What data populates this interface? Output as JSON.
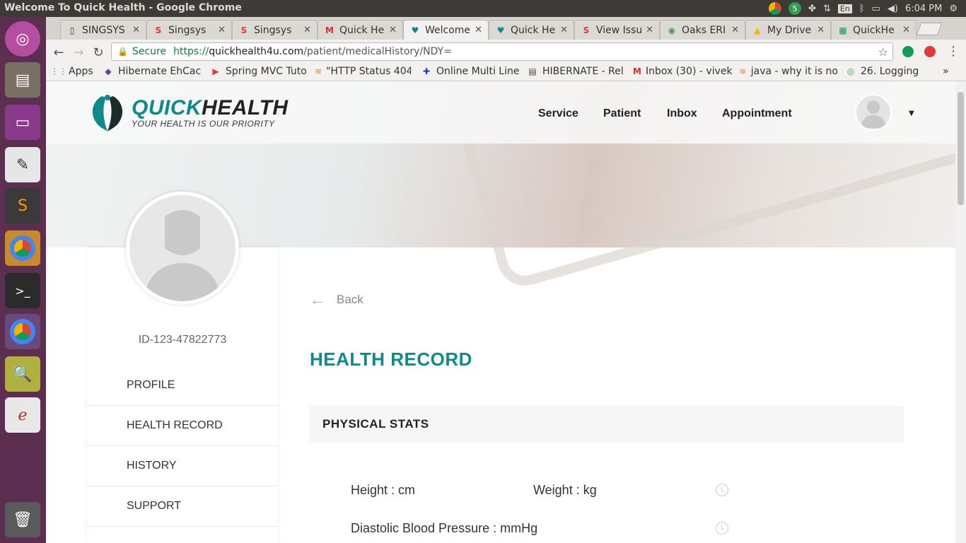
{
  "window": {
    "title": "Welcome To Quick Health - Google Chrome"
  },
  "tray": {
    "time": "6:04 PM",
    "lang": "En",
    "badge": "5"
  },
  "launcher": {
    "items": [
      "ubuntu-dash-icon",
      "files-icon",
      "window-icon",
      "text-editor-icon",
      "sublime-icon",
      "chrome-icon",
      "terminal-icon",
      "chrome-icon-2",
      "calc-icon",
      "app-icon",
      "trash-icon"
    ]
  },
  "tabs": [
    {
      "label": "SINGSYS",
      "fav": "▯"
    },
    {
      "label": "Singsys",
      "fav": "S"
    },
    {
      "label": "Singsys",
      "fav": "S"
    },
    {
      "label": "Quick He",
      "fav": "M"
    },
    {
      "label": "Welcome",
      "fav": "♥"
    },
    {
      "label": "Quick He",
      "fav": "♥"
    },
    {
      "label": "View Issu",
      "fav": "S"
    },
    {
      "label": "Oaks ERI",
      "fav": "◉"
    },
    {
      "label": "My Drive",
      "fav": "▲"
    },
    {
      "label": "QuickHe",
      "fav": "▦"
    }
  ],
  "address": {
    "secure": "Secure",
    "url_prefix": "https://",
    "url_host": "quickhealth4u.com",
    "url_path": "/patient/medicalHistory/NDY="
  },
  "bookmarks": [
    {
      "label": "Apps",
      "icon": "⋮⋮"
    },
    {
      "label": "Hibernate EhCac",
      "icon": "◆"
    },
    {
      "label": "Spring MVC Tuto",
      "icon": "▶"
    },
    {
      "label": "\"HTTP Status 404",
      "icon": "≋"
    },
    {
      "label": "Online Multi Line",
      "icon": "✚"
    },
    {
      "label": "HIBERNATE - Rel",
      "icon": "▤"
    },
    {
      "label": "Inbox (30) - vivek",
      "icon": "M"
    },
    {
      "label": "java - why it is no",
      "icon": "≋"
    },
    {
      "label": "26. Logging",
      "icon": "◎"
    }
  ],
  "site": {
    "brand_quick": "QUICK",
    "brand_health": "HEALTH",
    "tagline": "YOUR HEALTH IS OUR PRIORITY",
    "nav": [
      "Service",
      "Patient",
      "Inbox",
      "Appointment"
    ]
  },
  "profile": {
    "id": "ID-123-47822773"
  },
  "sidebar": {
    "items": [
      "PROFILE",
      "HEALTH RECORD",
      "HISTORY",
      "SUPPORT"
    ]
  },
  "main": {
    "back": "Back",
    "title": "HEALTH RECORD",
    "section": "PHYSICAL STATS",
    "stats": {
      "height": "Height : cm",
      "weight": "Weight : kg",
      "dbp": "Diastolic Blood Pressure : mmHg"
    }
  }
}
